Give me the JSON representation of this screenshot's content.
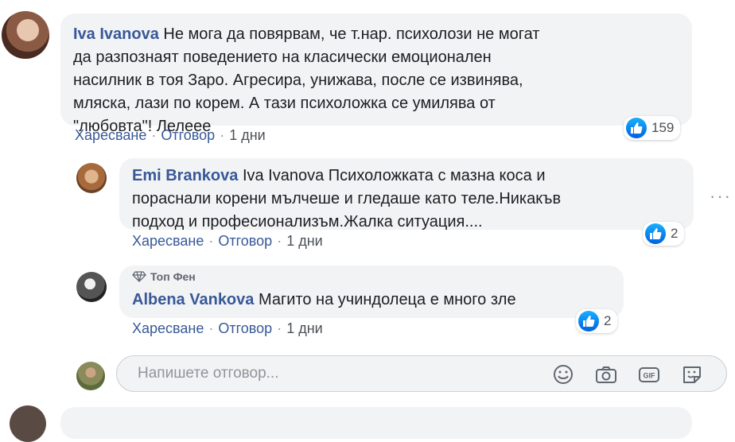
{
  "comments": [
    {
      "author": "Iva Ivanova",
      "text_lines": [
        " Не мога да повярвам, че т.нар. психолози не могат",
        "да разпознаят поведението на класически емоционален",
        "насилник в тоя Заро. Агресира, унижава, после се извинява,",
        "мляска, лази по корем. А тази психоложка се умилява от",
        "\"любовта\"! Лелеее"
      ],
      "like_label": "Харесване",
      "reply_label": "Отговор",
      "time": "1 дни",
      "reaction_count": "159"
    },
    {
      "author": "Emi Brankova",
      "text_lines": [
        " Iva Ivanova Психоложката с мазна коса и",
        "пораснали корени мълчеше и гледаше като теле.Никакъв",
        "подход и професионализъм.Жалка ситуация...."
      ],
      "like_label": "Харесване",
      "reply_label": "Отговор",
      "time": "1 дни",
      "reaction_count": "2"
    },
    {
      "badge": "Топ Фен",
      "author": "Albena Vankova",
      "text": " Магито на учиндолеца е много зле",
      "like_label": "Харесване",
      "reply_label": "Отговор",
      "time": "1 дни",
      "reaction_count": "2"
    }
  ],
  "reply_box": {
    "placeholder": "Напишете отговор...",
    "icons": [
      "emoji-icon",
      "camera-icon",
      "gif-icon",
      "sticker-icon"
    ]
  },
  "more_options": "···",
  "colors": {
    "author": "#385898",
    "bubble": "#f2f3f5",
    "like_blue": "#1877f2"
  }
}
